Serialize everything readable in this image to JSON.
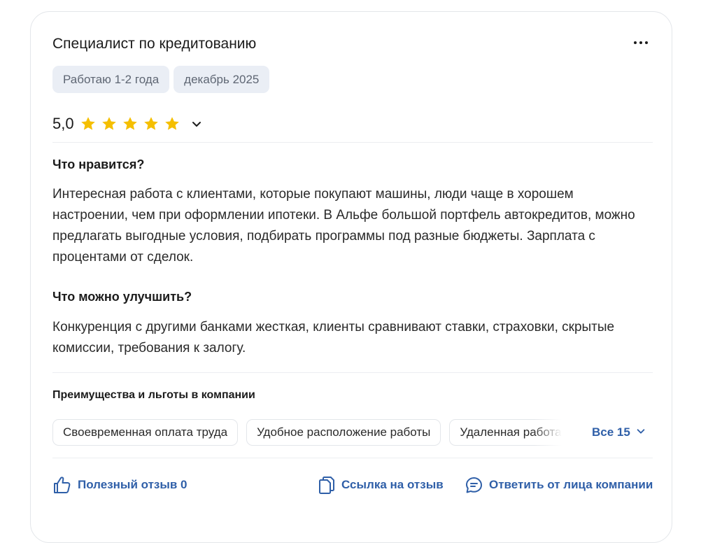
{
  "review": {
    "title": "Специалист по кредитованию",
    "tags": [
      "Работаю 1-2 года",
      "декабрь 2025"
    ],
    "rating": "5,0",
    "stars": 5,
    "likes": {
      "title": "Что нравится?",
      "text": "Интересная работа с клиентами, которые покупают машины, люди чаще в хорошем настроении, чем при оформлении ипотеки. В Альфе большой портфель автокредитов, можно предлагать выгодные условия, подбирать программы под разные бюджеты. Зарплата с процентами от сделок."
    },
    "improve": {
      "title": "Что можно улучшить?",
      "text": "Конкуренция с другими банками жесткая, клиенты сравнивают ставки, страховки, скрытые комиссии, требования к залогу."
    },
    "benefits": {
      "title": "Преимущества и льготы в компании",
      "items": [
        "Своевременная оплата труда",
        "Удобное расположение работы",
        "Удаленная работа"
      ],
      "show_all_label": "Все 15"
    },
    "actions": {
      "useful_label": "Полезный отзыв 0",
      "link_label": "Ссылка на отзыв",
      "reply_label": "Ответить от лица компании"
    }
  },
  "colors": {
    "accent": "#2f5fa8",
    "star": "#f5bf00",
    "chip_bg": "#eaeef5"
  }
}
